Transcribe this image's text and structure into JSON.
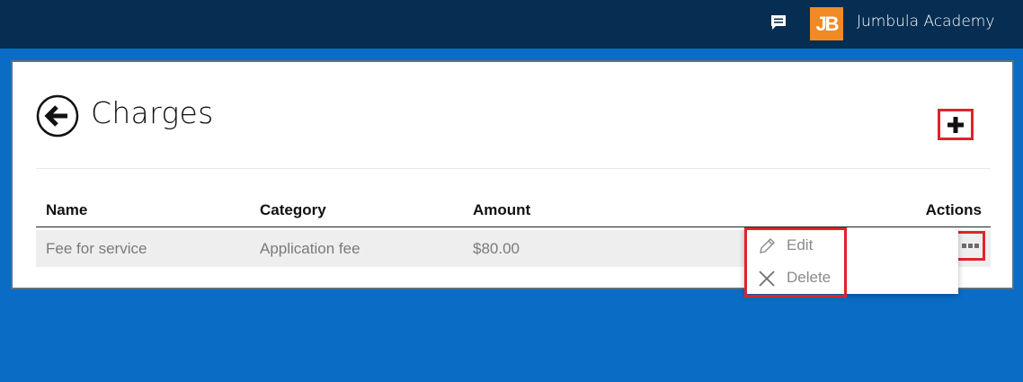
{
  "header": {
    "chat_icon": "chat-bubble-icon",
    "logo_text": "JB",
    "org_name": "Jumbula Academy",
    "colors": {
      "bar": "#062d52",
      "logo": "#f08a24"
    }
  },
  "page": {
    "title": "Charges",
    "back_icon": "arrow-left-circle-icon",
    "add_icon": "plus-icon",
    "background": "#0a6cc4"
  },
  "table": {
    "columns": [
      "Name",
      "Category",
      "Amount",
      "Actions"
    ],
    "rows": [
      {
        "name": "Fee for service",
        "category": "Application fee",
        "amount": "$80.00",
        "actions_icon": "more-horizontal-icon"
      }
    ]
  },
  "row_menu": {
    "items": [
      {
        "label": "Edit",
        "icon": "pencil-icon"
      },
      {
        "label": "Delete",
        "icon": "close-icon"
      }
    ]
  },
  "highlight_color": "#e0232c"
}
